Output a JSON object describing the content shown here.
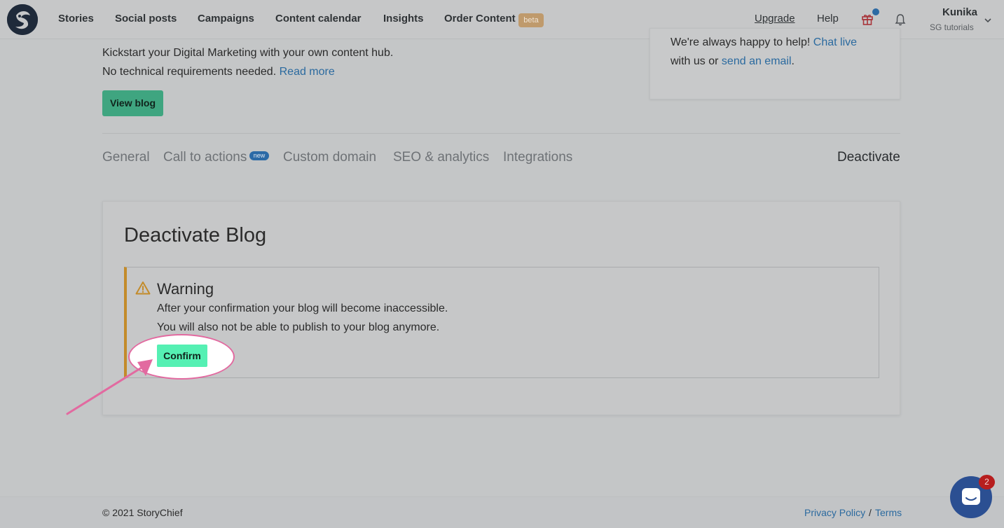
{
  "nav": {
    "items": [
      {
        "label": "Stories"
      },
      {
        "label": "Social posts"
      },
      {
        "label": "Campaigns"
      },
      {
        "label": "Content calendar"
      },
      {
        "label": "Insights"
      },
      {
        "label": "Order Content"
      }
    ],
    "beta_badge": "beta",
    "upgrade": "Upgrade",
    "help": "Help",
    "user_name": "Kunika",
    "user_org": "SG tutorials",
    "icons": [
      "logo-icon",
      "gift-icon",
      "bell-icon",
      "chevron-down-icon"
    ]
  },
  "intro": {
    "line1": "Kickstart your Digital Marketing with your own content hub.",
    "line2_prefix": "No technical requirements needed.",
    "line2_link": "Read more",
    "view_blog_button": "View blog"
  },
  "help_card": {
    "line1_prefix": "We're always happy to help!",
    "line1_link": "Chat live",
    "line2_prefix": "with us or",
    "line2_link": "send an email",
    "line2_suffix": "."
  },
  "tabs": [
    {
      "label": "General"
    },
    {
      "label": "Call to actions"
    },
    {
      "label": "Custom domain"
    },
    {
      "label": "SEO & analytics"
    },
    {
      "label": "Integrations"
    },
    {
      "label": "Deactivate"
    }
  ],
  "tab_new_badge": "new",
  "deactivate": {
    "title": "Deactivate Blog",
    "warning_heading": "Warning",
    "warning_line1": "After your confirmation your blog will become inaccessible.",
    "warning_line2": "You will also not be able to publish to your blog anymore.",
    "confirm_button": "Confirm"
  },
  "footer": {
    "copyright": "© 2021 StoryChief",
    "privacy": "Privacy Policy",
    "separator": "/",
    "terms": "Terms"
  },
  "chat": {
    "badge_count": "2"
  },
  "colors": {
    "accent_green": "#55f0b3",
    "annotation_pink": "#e26aa0",
    "warning_orange": "#c38b2a",
    "link_blue": "#2b6a9f"
  }
}
